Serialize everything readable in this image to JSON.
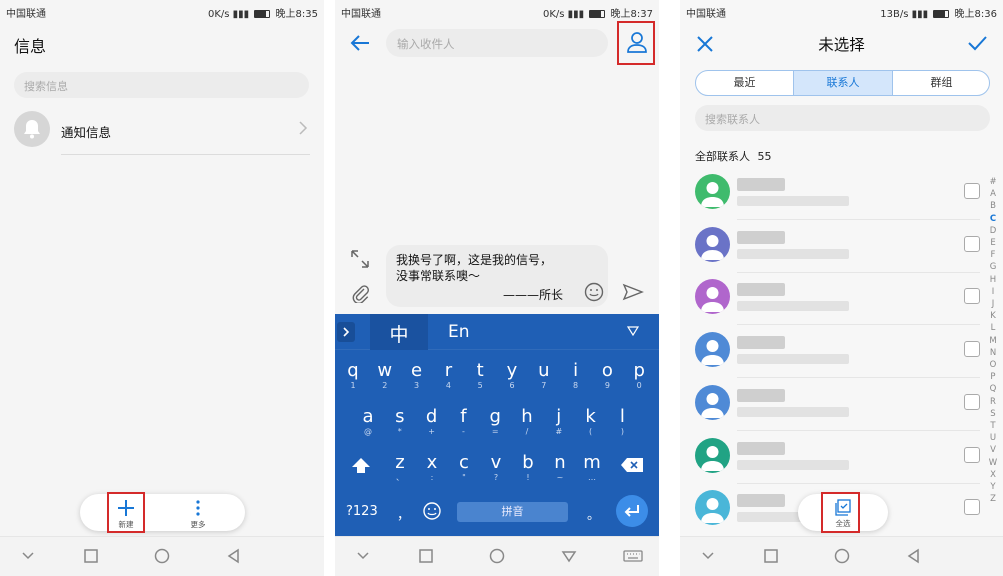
{
  "accent_color": "#1877d6",
  "highlight_color": "#d42a2a",
  "keyboard_color": "#1f5fb5",
  "status": {
    "p1": {
      "carrier": "中国联通",
      "speed": "0K/s",
      "time": "晚上8:35"
    },
    "p2": {
      "carrier": "中国联通",
      "speed": "0K/s",
      "time": "晚上8:37"
    },
    "p3": {
      "carrier": "中国联通",
      "speed": "13B/s",
      "time": "晚上8:36"
    }
  },
  "p1": {
    "title": "信息",
    "search_placeholder": "搜索信息",
    "notification_label": "通知信息",
    "actions": {
      "new_label": "新建",
      "more_label": "更多"
    }
  },
  "p2": {
    "recipient_placeholder": "输入收件人",
    "message_line1": "我换号了啊，这是我的信号，",
    "message_line2": "没事常联系噢～",
    "message_signature": "———所长",
    "keyboard": {
      "lang_zh": "中",
      "lang_en": "En",
      "row1": [
        [
          "q",
          "1"
        ],
        [
          "w",
          "2"
        ],
        [
          "e",
          "3"
        ],
        [
          "r",
          "4"
        ],
        [
          "t",
          "5"
        ],
        [
          "y",
          "6"
        ],
        [
          "u",
          "7"
        ],
        [
          "i",
          "8"
        ],
        [
          "o",
          "9"
        ],
        [
          "p",
          "0"
        ]
      ],
      "row2": [
        [
          "a",
          "@"
        ],
        [
          "s",
          "*"
        ],
        [
          "d",
          "+"
        ],
        [
          "f",
          "-"
        ],
        [
          "g",
          "="
        ],
        [
          "h",
          "/"
        ],
        [
          "j",
          "#"
        ],
        [
          "k",
          "("
        ],
        [
          "l",
          ")"
        ]
      ],
      "row3": [
        [
          "z",
          "、"
        ],
        [
          "x",
          ":"
        ],
        [
          "c",
          "\""
        ],
        [
          "v",
          "?"
        ],
        [
          "b",
          "!"
        ],
        [
          "n",
          "~"
        ],
        [
          "m",
          "…"
        ]
      ],
      "numeric_label": "?123",
      "comma_label": "，",
      "space_label": "拼音",
      "period_label": "。"
    }
  },
  "p3": {
    "title": "未选择",
    "tabs": [
      "最近",
      "联系人",
      "群组"
    ],
    "active_tab": 1,
    "search_placeholder": "搜索联系人",
    "all_contacts_label": "全部联系人",
    "contact_count": "55",
    "avatar_colors": [
      "#3fbb6d",
      "#6a73c7",
      "#b066cc",
      "#4f8ad6",
      "#4f8ad6",
      "#21a384",
      "#4ab6d8"
    ],
    "index_letters": [
      "#",
      "A",
      "B",
      "C",
      "D",
      "E",
      "F",
      "G",
      "H",
      "I",
      "J",
      "K",
      "L",
      "M",
      "N",
      "O",
      "P",
      "Q",
      "R",
      "S",
      "T",
      "U",
      "V",
      "W",
      "X",
      "Y",
      "Z"
    ],
    "active_letter": "C",
    "select_all_label": "全选"
  }
}
